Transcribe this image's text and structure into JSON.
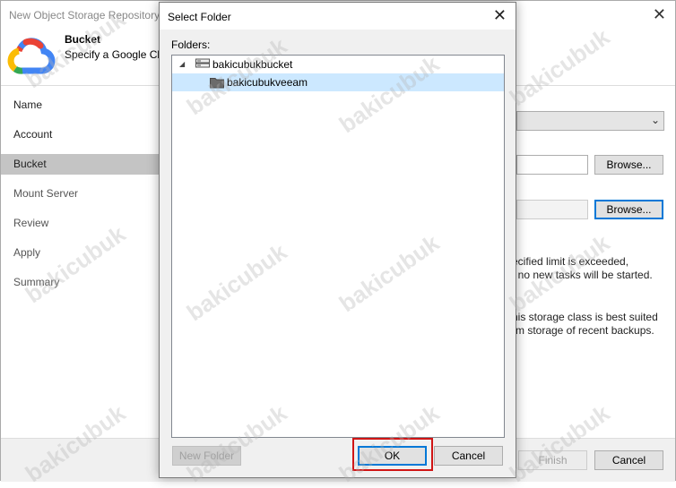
{
  "wizard": {
    "title": "New Object Storage Repository",
    "header_title": "Bucket",
    "header_subtitle": "Specify a Google Clo",
    "nav": [
      {
        "label": "Name"
      },
      {
        "label": "Account"
      },
      {
        "label": "Bucket"
      },
      {
        "label": "Mount Server"
      },
      {
        "label": "Review"
      },
      {
        "label": "Apply"
      },
      {
        "label": "Summary"
      }
    ],
    "active_nav": "Bucket",
    "browse_label_1": "Browse...",
    "browse_label_2": "Browse...",
    "text_limit_line1": "ecified limit is exceeded,",
    "text_limit_line2": "t no new tasks will be started.",
    "text_class_line1": "his storage class is best suited",
    "text_class_line2": "rm storage of recent backups.",
    "finish_label": "Finish",
    "cancel_label": "Cancel"
  },
  "dialog": {
    "title": "Select Folder",
    "folders_label": "Folders:",
    "tree": {
      "root": {
        "label": "bakicubukbucket",
        "expanded": true,
        "icon": "bucket-icon"
      },
      "children": [
        {
          "label": "bakicubukveeam",
          "selected": true,
          "icon": "folder-icon"
        }
      ]
    },
    "new_folder_label": "New Folder",
    "ok_label": "OK",
    "cancel_label": "Cancel"
  },
  "watermark": "bakicubuk",
  "colors": {
    "selection": "#cce8ff",
    "focus_border": "#0078d7",
    "highlight_box": "#d01515",
    "nav_active": "#c4c4c4"
  }
}
